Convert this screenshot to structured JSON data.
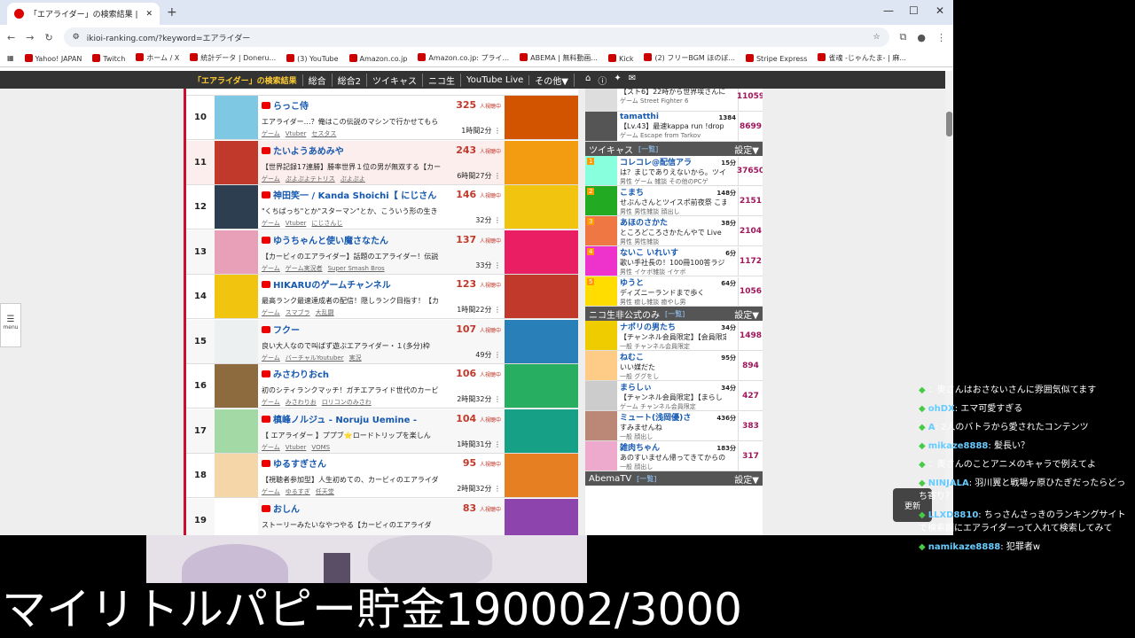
{
  "browser": {
    "tab_title": "「エアライダー」の検索結果 | 配信者",
    "url": "ikioi-ranking.com/?keyword=エアライダー",
    "bookmarks": [
      "Yahoo! JAPAN",
      "Twitch",
      "ホーム / X",
      "統計データ | Doneru...",
      "(3) YouTube",
      "Amazon.co.jp",
      "Amazon.co.jp: プライ...",
      "ABEMA | 無料動画...",
      "Kick",
      "(2) フリーBGM ほのぼ...",
      "Stripe Express",
      "雀魂 -じゃんたま- | 麻..."
    ]
  },
  "site_nav": [
    "「エアライダー」の検索結果",
    "総合",
    "総合2",
    "ツイキャス",
    "ニコ生",
    "YouTube Live",
    "その他▼"
  ],
  "main_rows": [
    {
      "rank": "10",
      "name": "らっこ侍",
      "viewers": "325",
      "desc": "エアライダー…？俺はこの伝説のマシンで行かせてもら",
      "tags": [
        "ゲーム",
        "Vtuber",
        "セスタス"
      ],
      "time": "1時間2分"
    },
    {
      "rank": "11",
      "name": "たいようあめみや",
      "viewers": "243",
      "desc": "【世界記録17連勝】勝率世界１位の男が無双する【カー",
      "tags": [
        "ゲーム",
        "ぷよぷよテトリス",
        "ぷよぷよ"
      ],
      "time": "6時間27分"
    },
    {
      "rank": "12",
      "name": "神田笑一 / Kanda Shoichi【 にじさん",
      "viewers": "146",
      "desc": "\"くちばっち\"とか\"スターマン\"とか、こういう形の生き",
      "tags": [
        "ゲーム",
        "Vtuber",
        "にじさんじ"
      ],
      "time": "32分"
    },
    {
      "rank": "13",
      "name": "ゆうちゃんと使い魔さなたん",
      "viewers": "137",
      "desc": "【カービィのエアライダー】話題のエアライダー！伝説",
      "tags": [
        "ゲーム",
        "ゲーム実況者",
        "Super Smash Bros"
      ],
      "time": "33分"
    },
    {
      "rank": "14",
      "name": "HIKARUのゲームチャンネル",
      "viewers": "123",
      "desc": "最高ランク最速達成者の配信！隠しランク目指す！【カ",
      "tags": [
        "ゲーム",
        "スマブラ",
        "大乱闘"
      ],
      "time": "1時間22分"
    },
    {
      "rank": "15",
      "name": "フクー",
      "viewers": "107",
      "desc": "良い大人なので叫ばず遊ぶエアライダー・１(多分)枠",
      "tags": [
        "ゲーム",
        "バーチャルYoutuber",
        "実況"
      ],
      "time": "49分"
    },
    {
      "rank": "16",
      "name": "みさわりおch",
      "viewers": "106",
      "desc": "初のシティランクマッチ！ガチエアライド世代のカービ",
      "tags": [
        "ゲーム",
        "みさわりお",
        "ロリコンのみさわ"
      ],
      "time": "2時間32分"
    },
    {
      "rank": "17",
      "name": "槙峰ノルジュ - Noruju Uemine -",
      "viewers": "104",
      "desc": "【 エアライダー 】ププブ⭐ロードトリップを楽しん",
      "tags": [
        "ゲーム",
        "Vtuber",
        "VOMS"
      ],
      "time": "1時間31分"
    },
    {
      "rank": "18",
      "name": "ゆるすぎさん",
      "viewers": "95",
      "desc": "【視聴者参加型】人生初めての、カービィのエアライダ",
      "tags": [
        "ゲーム",
        "ゆるすぎ",
        "任天堂"
      ],
      "time": "2時間32分"
    },
    {
      "rank": "19",
      "name": "おしん",
      "viewers": "83",
      "desc": "ストーリーみたいなやつやる【カービィのエアライダ",
      "tags": [],
      "time": ""
    }
  ],
  "viewing_label": "人視聴中",
  "right_top": [
    {
      "name": "",
      "desc": "【スト6】22時から世界埃さんにコ",
      "tags": "ゲーム Street Fighter 6",
      "mins": "",
      "viewers": "11059"
    },
    {
      "name": "tamatthi",
      "desc": "【Lv.43】最速kappa run !drop",
      "tags": "ゲーム Escape from Tarkov",
      "mins": "1384",
      "viewers": "8699"
    }
  ],
  "twitcas": {
    "title": "ツイキャス",
    "link": "[一覧]",
    "settings": "設定▼",
    "items": [
      {
        "name": "コレコレ@配信アラ",
        "desc": "は？まじでありえないから。ツイキ",
        "tags": "男性 ゲーム 雑談 その他のPCゲ",
        "mins": "15分",
        "viewers": "37650"
      },
      {
        "name": "こまち",
        "desc": "せぶんさんとツイスポ前夜祭 こまち",
        "tags": "男性 男性雑談 顔出し",
        "mins": "148分",
        "viewers": "2151"
      },
      {
        "name": "あほのさかた",
        "desc": "ところどころさかたんやで Live",
        "tags": "男性 男性雑談",
        "mins": "38分",
        "viewers": "2104"
      },
      {
        "name": "ないこ いれいす",
        "desc": "歌い手社長の！100冊100答ラジ",
        "tags": "男性 イケボ雑談 イケボ",
        "mins": "6分",
        "viewers": "1172"
      },
      {
        "name": "ゆうと",
        "desc": "ディズニーランドまで歩く",
        "tags": "男性 癒し雑談 癒やし男",
        "mins": "64分",
        "viewers": "1056"
      }
    ]
  },
  "nico": {
    "title": "ニコ生非公式のみ",
    "link": "[一覧]",
    "settings": "設定▼",
    "items": [
      {
        "name": "ナポリの男たち",
        "desc": "【チャンネル会員限定】【会員限定】",
        "tags": "一般 チャンネル会員限定",
        "mins": "34分",
        "viewers": "1498"
      },
      {
        "name": "ねむこ",
        "desc": "いい媒だた",
        "tags": "一般 ググをし",
        "mins": "95分",
        "viewers": "894"
      },
      {
        "name": "まらしぃ",
        "desc": "【チャンネル会員限定】【まらし",
        "tags": "ゲーム チャンネル会員限定",
        "mins": "34分",
        "viewers": "427"
      },
      {
        "name": "ミュート(浅岡優)さ",
        "desc": "すみませんね",
        "tags": "一般 顔出し",
        "mins": "436分",
        "viewers": "383"
      },
      {
        "name": "雑肉ちゃん",
        "desc": "あのすいません帰ってきてからのは",
        "tags": "一般 顔出し",
        "mins": "183分",
        "viewers": "317"
      }
    ]
  },
  "abema": {
    "title": "AbemaTV",
    "link": "[一覧]",
    "settings": "設定▼"
  },
  "menu_label": "menu",
  "reload_label": "更新",
  "chat": [
    {
      "user": "",
      "text": "：奥さんはおさないさんに雰囲気似てます"
    },
    {
      "user": "ohDX",
      "text": ": エマ可愛すぎる"
    },
    {
      "user": "A",
      "text": ": 2人のバトラから愛されたコンテンツ"
    },
    {
      "user": "mikaze8888",
      "text": ": 髪長い？"
    },
    {
      "user": "",
      "text": "：奥さんのことアニメのキャラで例えてよ"
    },
    {
      "user": "NINJALA",
      "text": ": 羽川翼と戦場ヶ原ひたぎだったらどっち寄り？"
    },
    {
      "user": "LLXD8810",
      "text": ": ちっさんさっきのランキングサイトで検索欄にエアライダーって入れて検索してみて"
    },
    {
      "user": "namikaze8888",
      "text": ": 犯罪者w"
    }
  ],
  "caption": "マイリトルパピー貯金190002/3000"
}
